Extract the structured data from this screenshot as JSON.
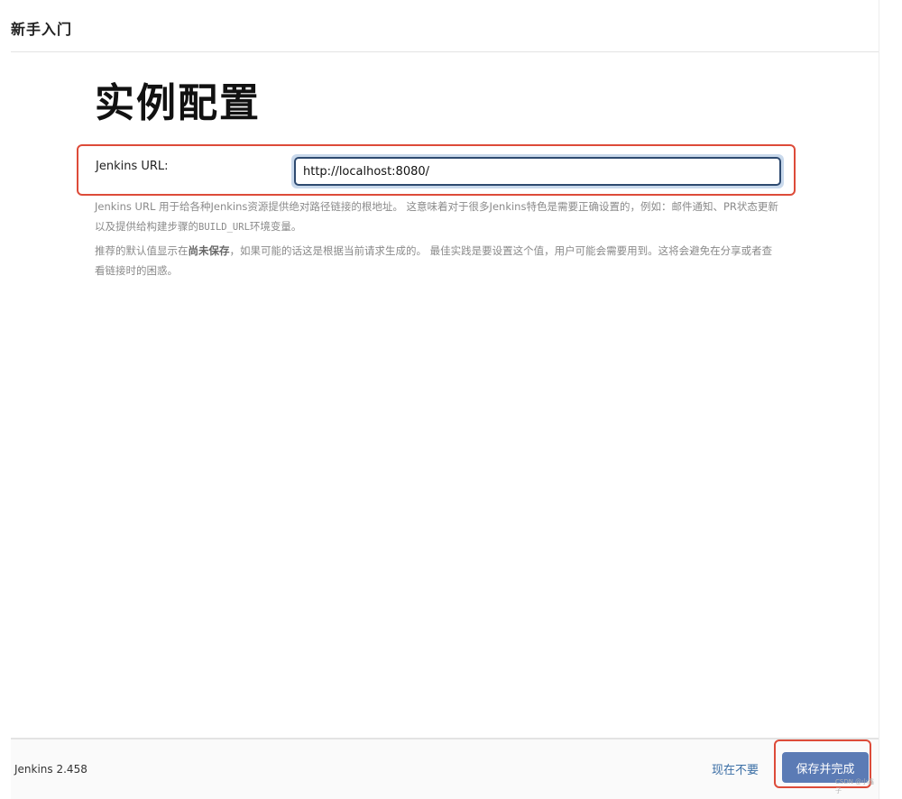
{
  "header": {
    "title": "新手入门"
  },
  "main": {
    "title": "实例配置",
    "url_field": {
      "label": "Jenkins URL:",
      "value": "http://localhost:8080/"
    },
    "help": {
      "p1": "Jenkins URL 用于给各种Jenkins资源提供绝对路径链接的根地址。 这意味着对于很多Jenkins特色是需要正确设置的，例如：邮件通知、PR状态更新以及提供给构建步骤的",
      "p1_code": "BUILD_URL",
      "p1_end": "环境变量。",
      "p2_start": "推荐的默认值显示在",
      "p2_strong": "尚未保存",
      "p2_end": "，如果可能的话这是根据当前请求生成的。 最佳实践是要设置这个值，用户可能会需要用到。这将会避免在分享或者查看链接时的困惑。"
    }
  },
  "footer": {
    "version": "Jenkins 2.458",
    "skip_label": "现在不要",
    "save_label": "保存并完成",
    "watermark": "CSDN @小鑫子"
  },
  "colors": {
    "accent": "#5b7bb5",
    "highlight_border": "#dd4b39",
    "link": "#3a6ea5"
  }
}
